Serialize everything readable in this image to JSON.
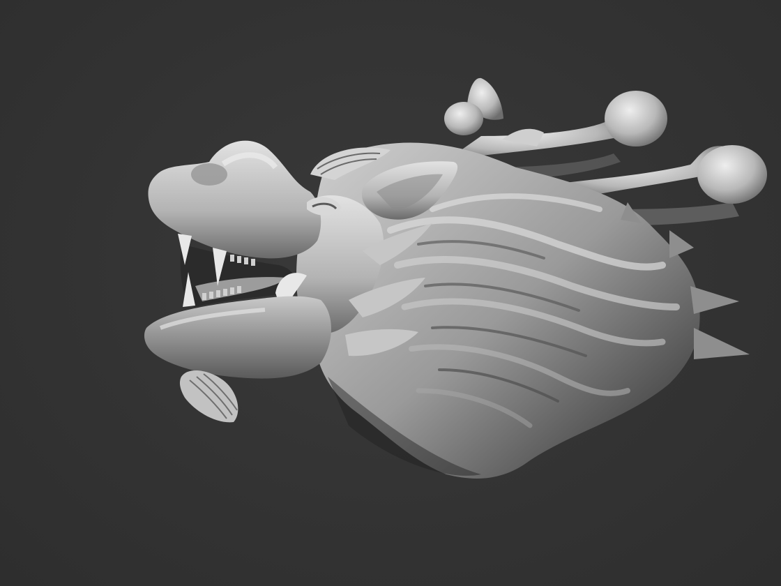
{
  "scene": {
    "subject": "dragon-head-sculpt",
    "background_color": "#333333",
    "material_color": "#bdbdbd",
    "shadow_color": "#1e1e1e",
    "highlight_color": "#e6e6e6"
  }
}
